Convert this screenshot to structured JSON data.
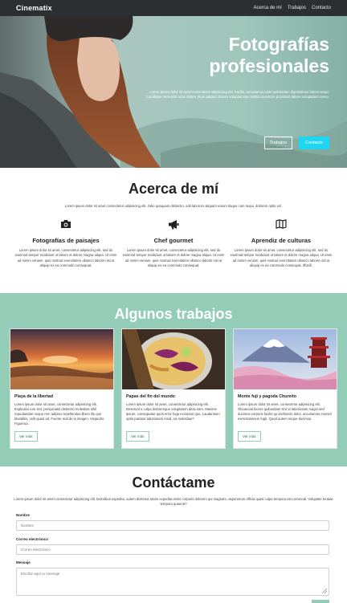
{
  "nav": {
    "brand": "Cinematix",
    "links": [
      "Acerca de mí",
      "Trabajos",
      "Contacto"
    ]
  },
  "hero": {
    "title": "Fotografías profesionales",
    "text": "Lorem ipsum dolor sit amet consectetur adipisicing elit. Facilis, accusamus iusto quibusdam dignissimos labore sequi. Cupiditate reiciendis esse dolore, illum adipisci harum voluptas iste mollitia inventore provident labore voluptatum nemo.",
    "btn_works": "Trabajos",
    "btn_contact": "Contacto"
  },
  "about": {
    "title": "Acerca de mí",
    "intro": "Lorem ipsum dolor sit amet consectetur adipisicing elit. Odio quaquam distinctio, odit laborum aliquam earum itaque cum sequi, dolorem optio vel.",
    "features": [
      {
        "icon": "camera-icon",
        "title": "Fotografías de paisajes",
        "desc": "Lorem ipsum dolor sit amet, consectetur adipisicing elit, sed do eiusmod tempor incididunt ut labore et dolore magna aliqua. Ut enim ad minim veniam, quis nostrud exercitation ullamco laboris nisi ut aliquip ex ea commodo consequat."
      },
      {
        "icon": "megaphone-icon",
        "title": "Chef gourmet",
        "desc": "Lorem ipsum dolor sit amet, consectetur adipisicing elit, sed do eiusmod tempor incididunt ut labore et dolore magna aliqua. Ut enim ad minim veniam, quis nostrud exercitation ullamco laboris nisi ut aliquip ex ea commodo consequat."
      },
      {
        "icon": "map-icon",
        "title": "Aprendiz de culturas",
        "desc": "Lorem ipsum dolor sit amet, consectetur adipisicing elit, sed do eiusmod tempor incididunt ut labore et dolore magna aliqua. Ut enim ad minim veniam, quis nostrud exercitation ullamco laboris nisi ut aliquip ex ea commodo consequat. Iffosifi."
      }
    ]
  },
  "works": {
    "title": "Algunos trabajos",
    "cards": [
      {
        "title": "Playa de la libertad",
        "desc": "Lorem ipsum dolor sit amet, consectetur adipisicing elit. Explicabo iure sint, perspiciatis distinctio molestias nihil repudiandae neque rem adipisci repellendus libero illo quo blanditiis, velit quasi ad. Fuente real de la imagen, Alejandro Figueroa.",
        "button": "Ver más"
      },
      {
        "title": "Papas del fin del mundo",
        "desc": "Lorem ipsum dolor sit amet, consectetur adipisicing elit. Deserunt a culpa doloremque voluptatem dicta nam. Maxime ipsum, consequatur quos error fuga excepturi quo. Laudantium optio pariatur laboriosam modi, ea molestiae?",
        "button": "Ver más"
      },
      {
        "title": "Monte fuji y pagoda Chureito",
        "desc": "Lorem ipsum dolor sit amet, consectetur adipisicing elit. Obcaecati facere quibusdam sint ut laboriosam magni sed ducimus corporis facilis qu architecto dolor, accusamus eveniet exercitationem fugit. Quod autem neque ducimus.",
        "button": "Ver más"
      }
    ]
  },
  "contact": {
    "title": "Contáctame",
    "intro": "Lorem ipsum dolor sit amet consectetur adipisicing elit. Doloribus expedita, autem delectus totam expedita animi corporis dolorem qui magnam, asperiorum officia quasi culpa tempora est commodi. Voluptate beatae tempora quaerat?",
    "name_label": "Nombre",
    "name_placeholder": "Nombre",
    "email_label": "Correo electrónico",
    "email_placeholder": "Correo electrónico",
    "message_label": "Mensaje",
    "message_placeholder": "Escribe aquí tu mensaje"
  },
  "colors": {
    "nav_bg": "#2b2f31",
    "works_bg": "#94cdb7",
    "accent_cyan": "#1fd6f0"
  }
}
